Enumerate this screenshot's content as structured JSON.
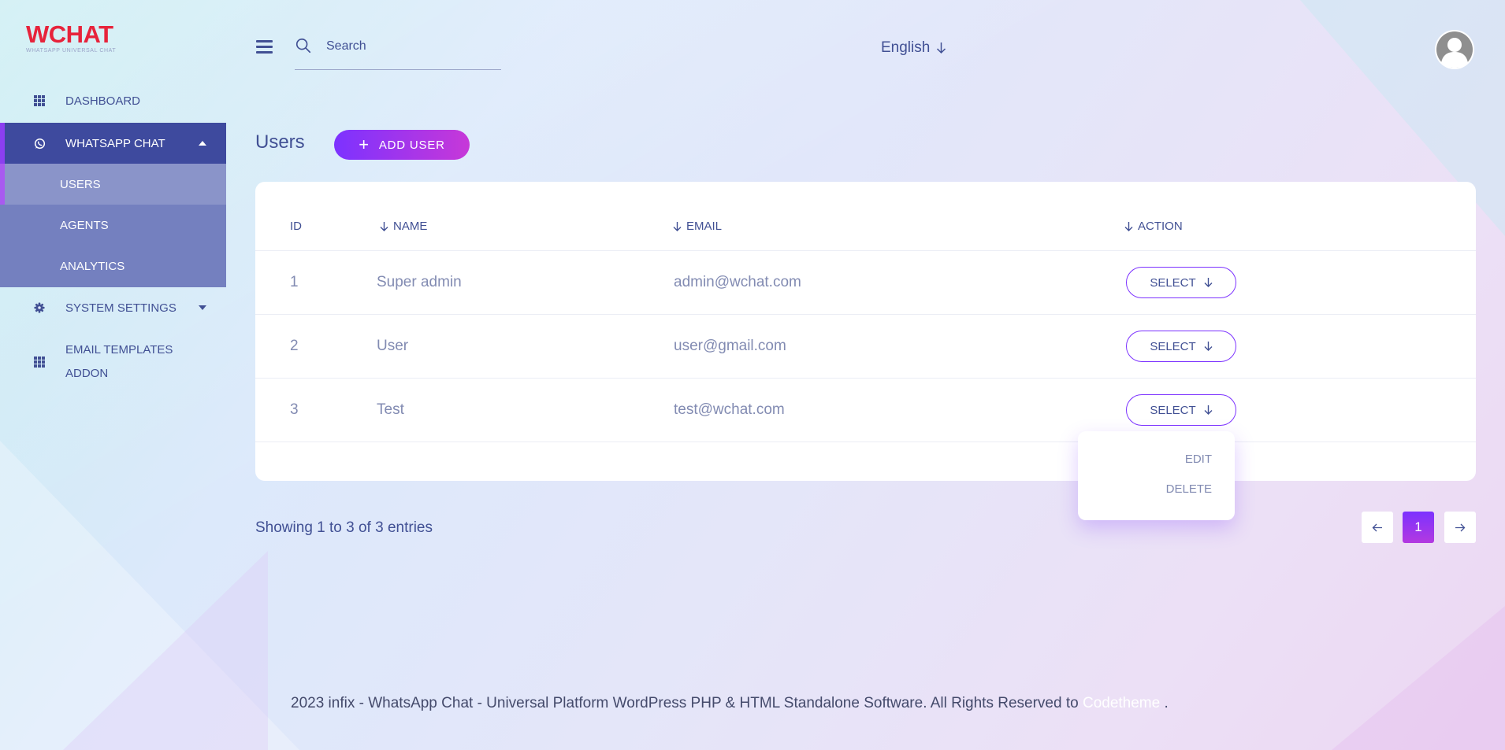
{
  "brand": {
    "name": "WCHAT",
    "tagline": "WHATSAPP UNIVERSAL CHAT"
  },
  "sidebar": {
    "items": [
      {
        "label": "DASHBOARD",
        "icon": "grid-icon"
      },
      {
        "label": "WHATSAPP CHAT",
        "icon": "whatsapp-icon",
        "expanded": true
      },
      {
        "label": "SYSTEM SETTINGS",
        "icon": "gear-icon"
      },
      {
        "label": "EMAIL TEMPLATES ADDON",
        "icon": "grid-icon"
      }
    ],
    "submenu": [
      {
        "label": "USERS",
        "active": true
      },
      {
        "label": "AGENTS"
      },
      {
        "label": "ANALYTICS"
      }
    ]
  },
  "header": {
    "search_placeholder": "Search",
    "language": "English"
  },
  "main": {
    "title": "Users",
    "add_button": "ADD USER",
    "table": {
      "columns": [
        "ID",
        "NAME",
        "EMAIL",
        "ACTION"
      ],
      "rows": [
        {
          "id": "1",
          "name": "Super admin",
          "email": "admin@wchat.com",
          "action": "SELECT"
        },
        {
          "id": "2",
          "name": "User",
          "email": "user@gmail.com",
          "action": "SELECT"
        },
        {
          "id": "3",
          "name": "Test",
          "email": "test@wchat.com",
          "action": "SELECT"
        }
      ]
    },
    "dropdown": {
      "items": [
        "EDIT",
        "DELETE"
      ]
    },
    "showing": "Showing 1 to 3 of 3 entries",
    "pagination": {
      "current": "1"
    }
  },
  "footer": {
    "text": "2023 infix - WhatsApp Chat - Universal Platform WordPress PHP & HTML Standalone Software. All Rights Reserved to ",
    "link": "Codetheme",
    "suffix": " ."
  },
  "colors": {
    "accent": "#7c32ff",
    "brand_red": "#e7233b",
    "nav_active": "#3e4a9e",
    "submenu": "#7480bf",
    "text": "#415094"
  }
}
